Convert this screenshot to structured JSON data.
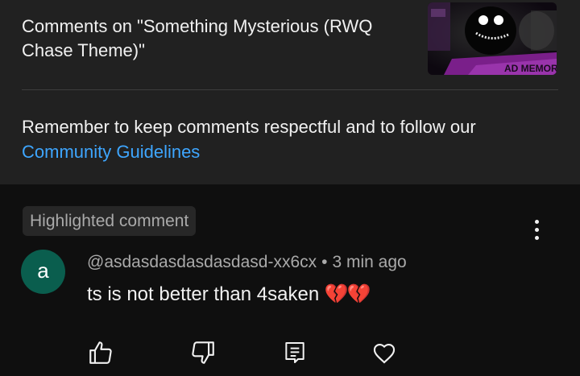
{
  "header": {
    "title": "Comments on \"Something Mysterious (RWQ Chase Theme)\"",
    "thumbnail_icon": "video-thumbnail"
  },
  "reminder": {
    "text": "Remember to keep comments respectful and to follow our",
    "link_label": "Community Guidelines"
  },
  "comment": {
    "badge": "Highlighted comment",
    "avatar_letter": "a",
    "author": "@asdasdasdasdasdasd-xx6cx",
    "separator": "•",
    "time": "3 min ago",
    "text": "ts is not better than 4saken",
    "emoji": "💔💔",
    "menu_icon": "more-vert-icon"
  },
  "actions": [
    {
      "icon": "thumbs-up-icon"
    },
    {
      "icon": "thumbs-down-icon"
    },
    {
      "icon": "reply-icon"
    },
    {
      "icon": "heart-icon"
    }
  ],
  "colors": {
    "panel": "#212121",
    "background": "#0f0f0f",
    "link": "#3ea6ff",
    "avatar": "#0a5e4e",
    "secondary_text": "#aaaaaa"
  }
}
